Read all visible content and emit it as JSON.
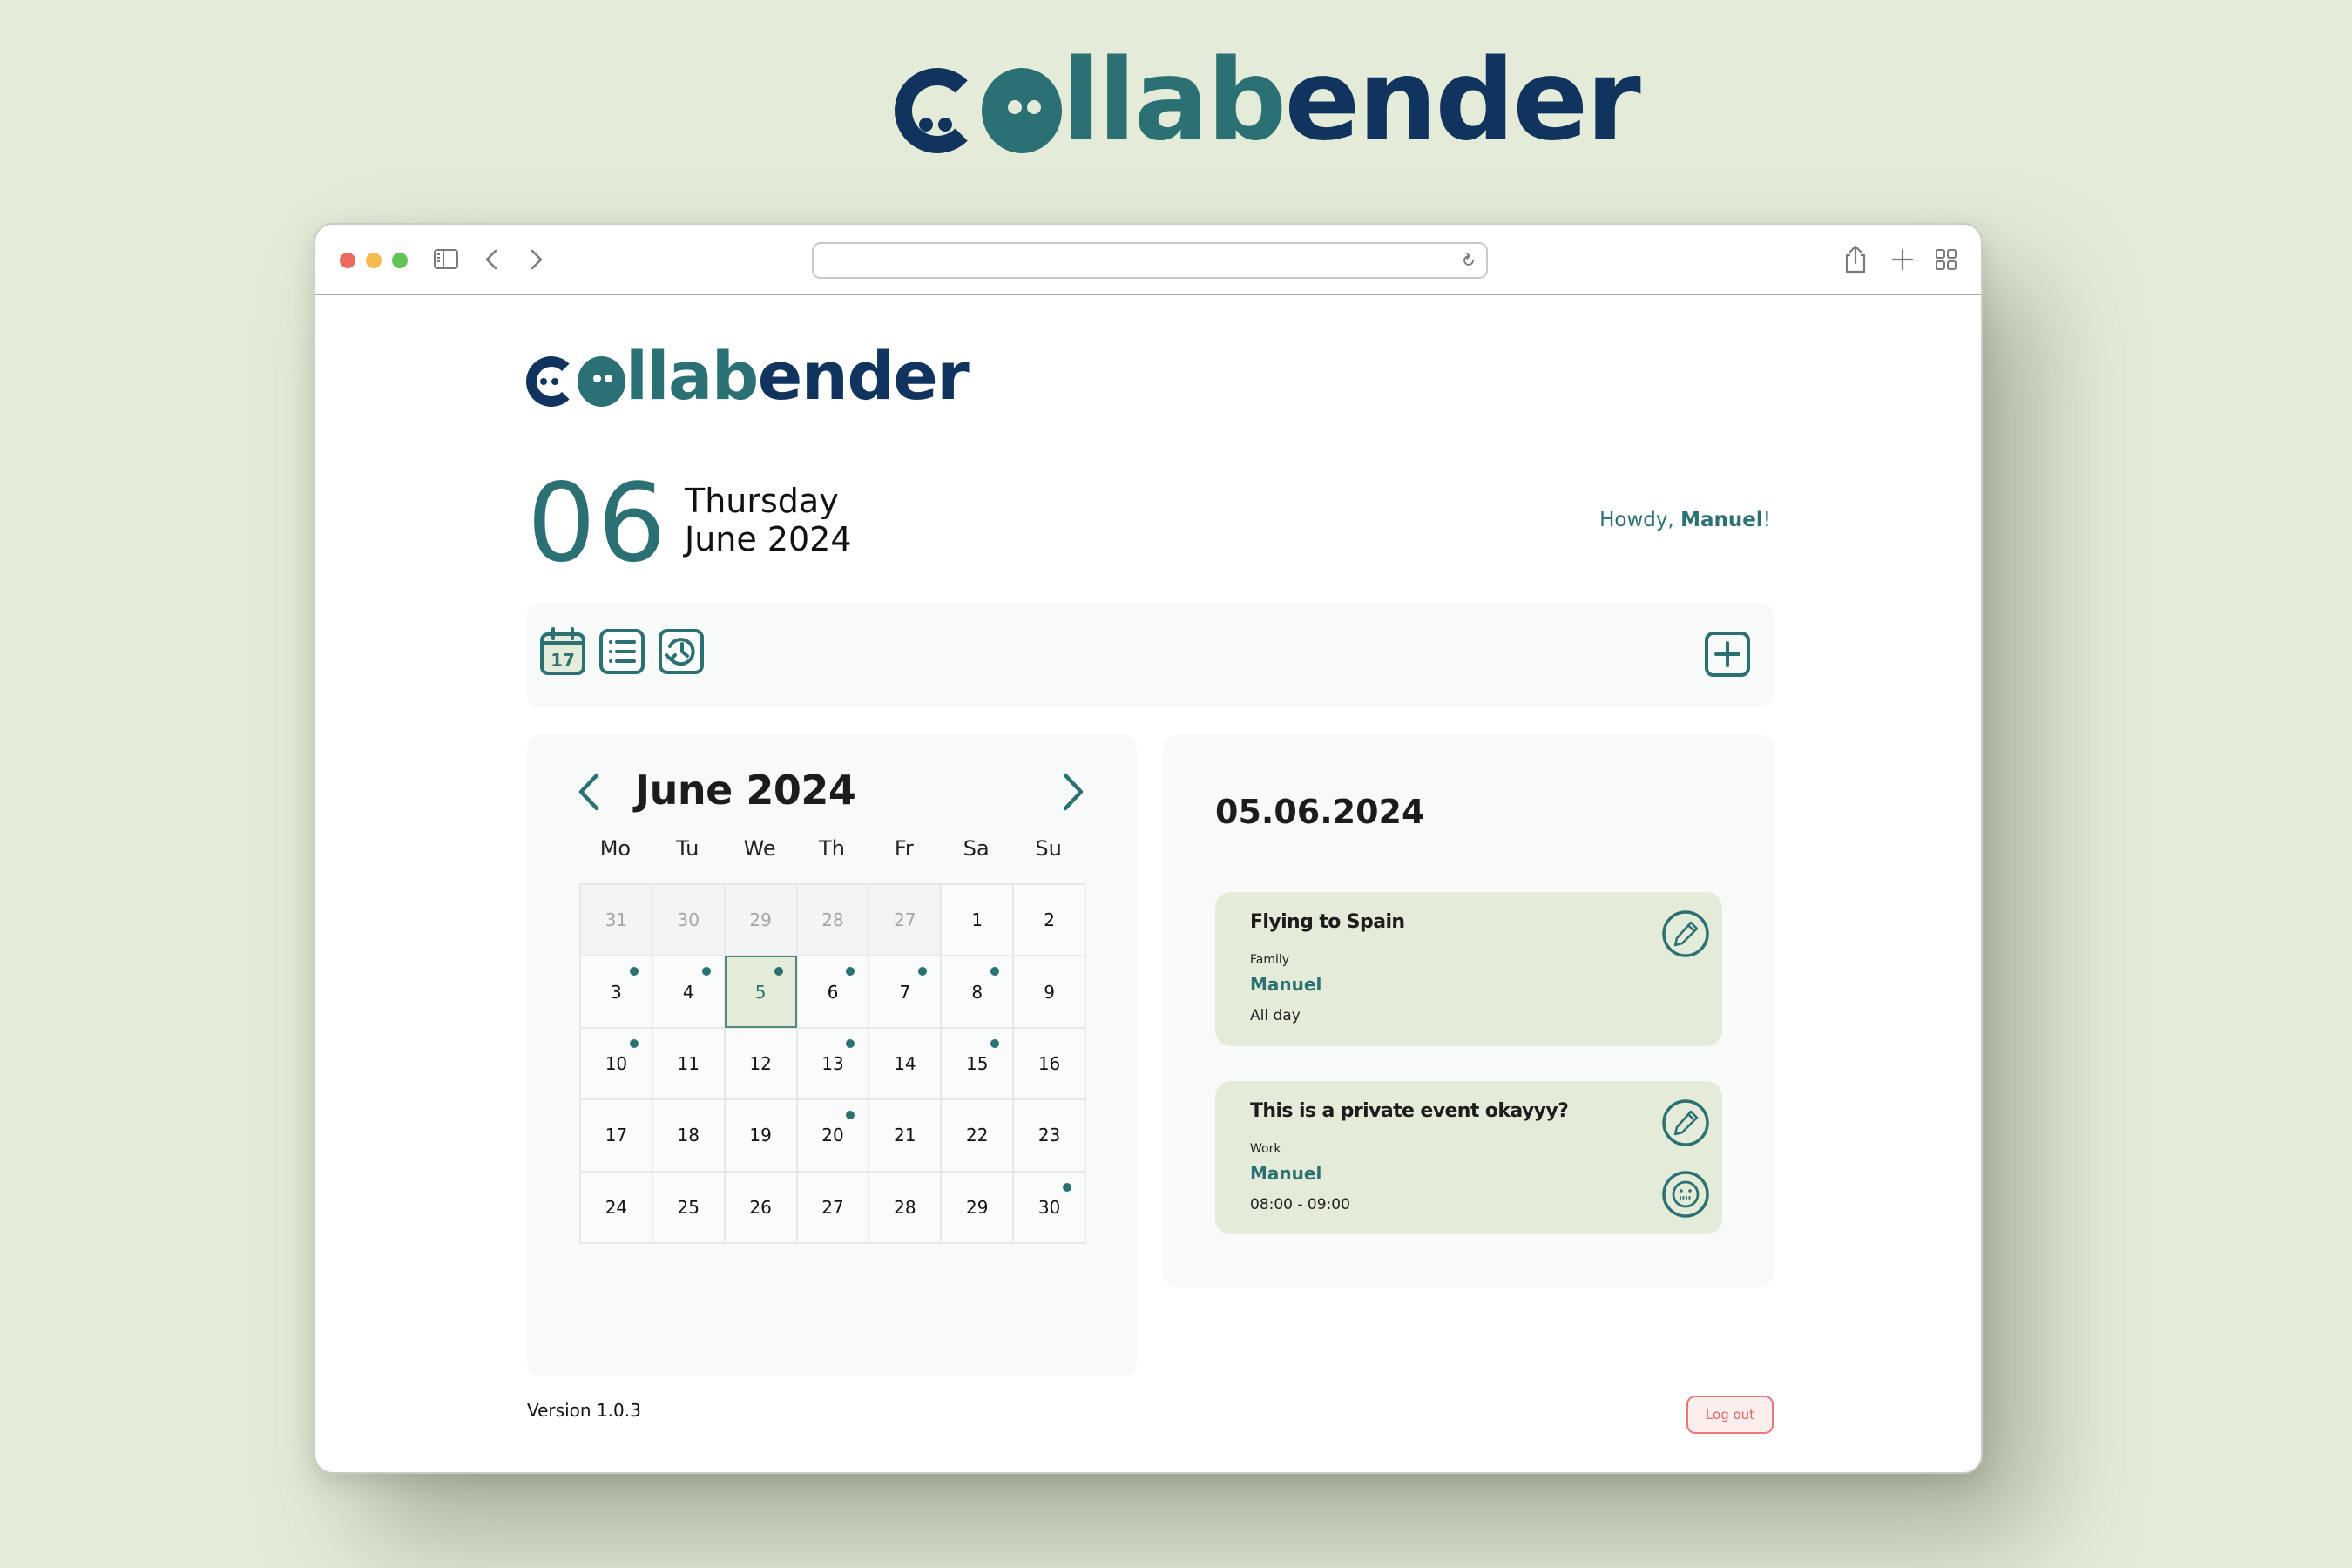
{
  "brand": {
    "name_parts": [
      "c",
      "o",
      "llab",
      "ender"
    ],
    "colors": {
      "navy": "#10345d",
      "teal": "#2b7173",
      "background": "#e4ecd9"
    }
  },
  "browser": {
    "url": "",
    "icons": [
      "sidebar-icon",
      "chevron-left-icon",
      "chevron-right-icon",
      "reload-icon",
      "share-icon",
      "plus-icon",
      "tab-overview-icon"
    ]
  },
  "header": {
    "day_number": "06",
    "weekday": "Thursday",
    "month_year": "June 2024",
    "greeting": "Howdy,",
    "user_name": "Manuel",
    "greeting_suffix": "!"
  },
  "toolbar": {
    "views": [
      {
        "name": "calendar-view",
        "icon": "calendar-icon",
        "badge": "17"
      },
      {
        "name": "list-view",
        "icon": "list-icon"
      },
      {
        "name": "history-view",
        "icon": "history-icon"
      }
    ],
    "add_icon": "plus-square-icon"
  },
  "calendar": {
    "title": "June 2024",
    "weekdays": [
      "Mo",
      "Tu",
      "We",
      "Th",
      "Fr",
      "Sa",
      "Su"
    ],
    "selected_day": 5,
    "cells": [
      {
        "d": "31",
        "other": true
      },
      {
        "d": "30",
        "other": true
      },
      {
        "d": "29",
        "other": true
      },
      {
        "d": "28",
        "other": true
      },
      {
        "d": "27",
        "other": true
      },
      {
        "d": "1"
      },
      {
        "d": "2"
      },
      {
        "d": "3",
        "dot": true
      },
      {
        "d": "4",
        "dot": true
      },
      {
        "d": "5",
        "dot": true,
        "selected": true
      },
      {
        "d": "6",
        "dot": true
      },
      {
        "d": "7",
        "dot": true
      },
      {
        "d": "8",
        "dot": true
      },
      {
        "d": "9"
      },
      {
        "d": "10",
        "dot": true
      },
      {
        "d": "11"
      },
      {
        "d": "12"
      },
      {
        "d": "13",
        "dot": true
      },
      {
        "d": "14"
      },
      {
        "d": "15",
        "dot": true
      },
      {
        "d": "16"
      },
      {
        "d": "17"
      },
      {
        "d": "18"
      },
      {
        "d": "19"
      },
      {
        "d": "20",
        "dot": true
      },
      {
        "d": "21"
      },
      {
        "d": "22"
      },
      {
        "d": "23"
      },
      {
        "d": "24"
      },
      {
        "d": "25"
      },
      {
        "d": "26"
      },
      {
        "d": "27"
      },
      {
        "d": "28"
      },
      {
        "d": "29"
      },
      {
        "d": "30",
        "dot": true
      }
    ]
  },
  "events": {
    "date": "05.06.2024",
    "items": [
      {
        "title": "Flying to Spain",
        "category": "Family",
        "owner": "Manuel",
        "time": "All day",
        "private": false
      },
      {
        "title": "This is a private event okayyy?",
        "category": "Work",
        "owner": "Manuel",
        "time": "08:00 - 09:00",
        "private": true
      }
    ]
  },
  "footer": {
    "version": "Version 1.0.3",
    "logout_label": "Log out"
  }
}
